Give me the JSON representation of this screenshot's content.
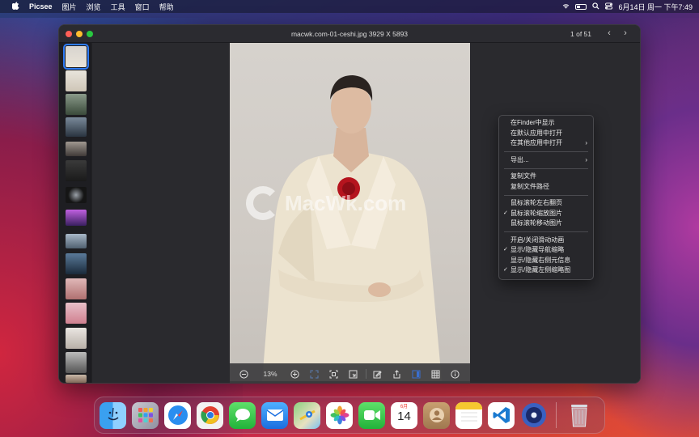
{
  "menubar": {
    "app_name": "Picsee",
    "menus": [
      "图片",
      "浏览",
      "工具",
      "窗口",
      "帮助"
    ],
    "clock": "6月14日 周一 下午7:49"
  },
  "window": {
    "title": "macwk.com-01-ceshi.jpg 3929 X 5893",
    "page_count": "1 of 51",
    "prev": "‹",
    "next": "›"
  },
  "viewer": {
    "watermark": "MacWk.com",
    "zoom": "13%"
  },
  "context_menu": {
    "items": [
      {
        "label": "在Finder中显示",
        "checked": false,
        "submenu": false
      },
      {
        "label": "在默认应用中打开",
        "checked": false,
        "submenu": false
      },
      {
        "label": "在其他应用中打开",
        "checked": false,
        "submenu": true
      },
      {
        "label": "导出...",
        "checked": false,
        "submenu": true
      },
      {
        "label": "复制文件",
        "checked": false,
        "submenu": false
      },
      {
        "label": "复制文件路径",
        "checked": false,
        "submenu": false
      },
      {
        "label": "鼠标滚轮左右翻页",
        "checked": false,
        "submenu": false
      },
      {
        "label": "鼠标滚轮缩放图片",
        "checked": true,
        "submenu": false
      },
      {
        "label": "鼠标滚轮移动图片",
        "checked": false,
        "submenu": false
      },
      {
        "label": "开启/关闭滑动动画",
        "checked": false,
        "submenu": false
      },
      {
        "label": "显示/隐藏导航缩略",
        "checked": true,
        "submenu": false
      },
      {
        "label": "显示/隐藏右侧元信息",
        "checked": false,
        "submenu": false
      },
      {
        "label": "显示/隐藏左侧缩略图",
        "checked": true,
        "submenu": false
      }
    ],
    "check_glyph": "✓",
    "submenu_glyph": "›"
  },
  "dock": {
    "calendar_month": "6月",
    "calendar_day": "14"
  }
}
